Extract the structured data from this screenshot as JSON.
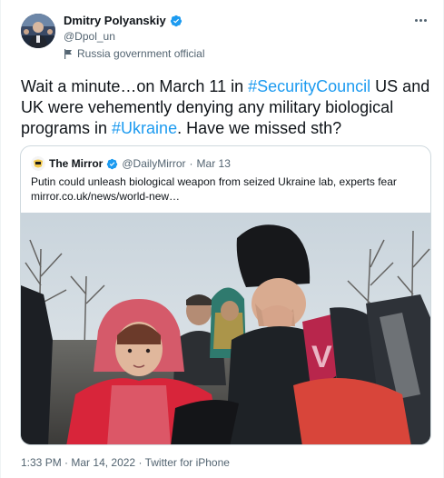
{
  "author": {
    "name": "Dmitry Polyanskiy",
    "handle": "@Dpol_un",
    "label": "Russia government official"
  },
  "tweet": {
    "text_1": "Wait a minute…on March 11 in ",
    "hashtag_1": "#SecurityCouncil",
    "text_2": " US and UK were vehemently denying any military biological programs in ",
    "hashtag_2": "#Ukraine",
    "text_3": ". Have we missed sth?"
  },
  "quote": {
    "name": "The Mirror",
    "handle": "@DailyMirror",
    "separator": "·",
    "date": "Mar 13",
    "text_line_1": "Putin could unleash biological weapon from seized Ukraine lab, experts fear",
    "text_line_2": "mirror.co.uk/news/world-new…"
  },
  "footer": {
    "time": "1:33 PM",
    "separator": "·",
    "date": "Mar 14, 2022",
    "source": "Twitter for iPhone"
  },
  "colors": {
    "link": "#1d9bf0",
    "secondary_text": "#536471",
    "primary_text": "#0f1419",
    "verified": "#1d9bf0"
  }
}
